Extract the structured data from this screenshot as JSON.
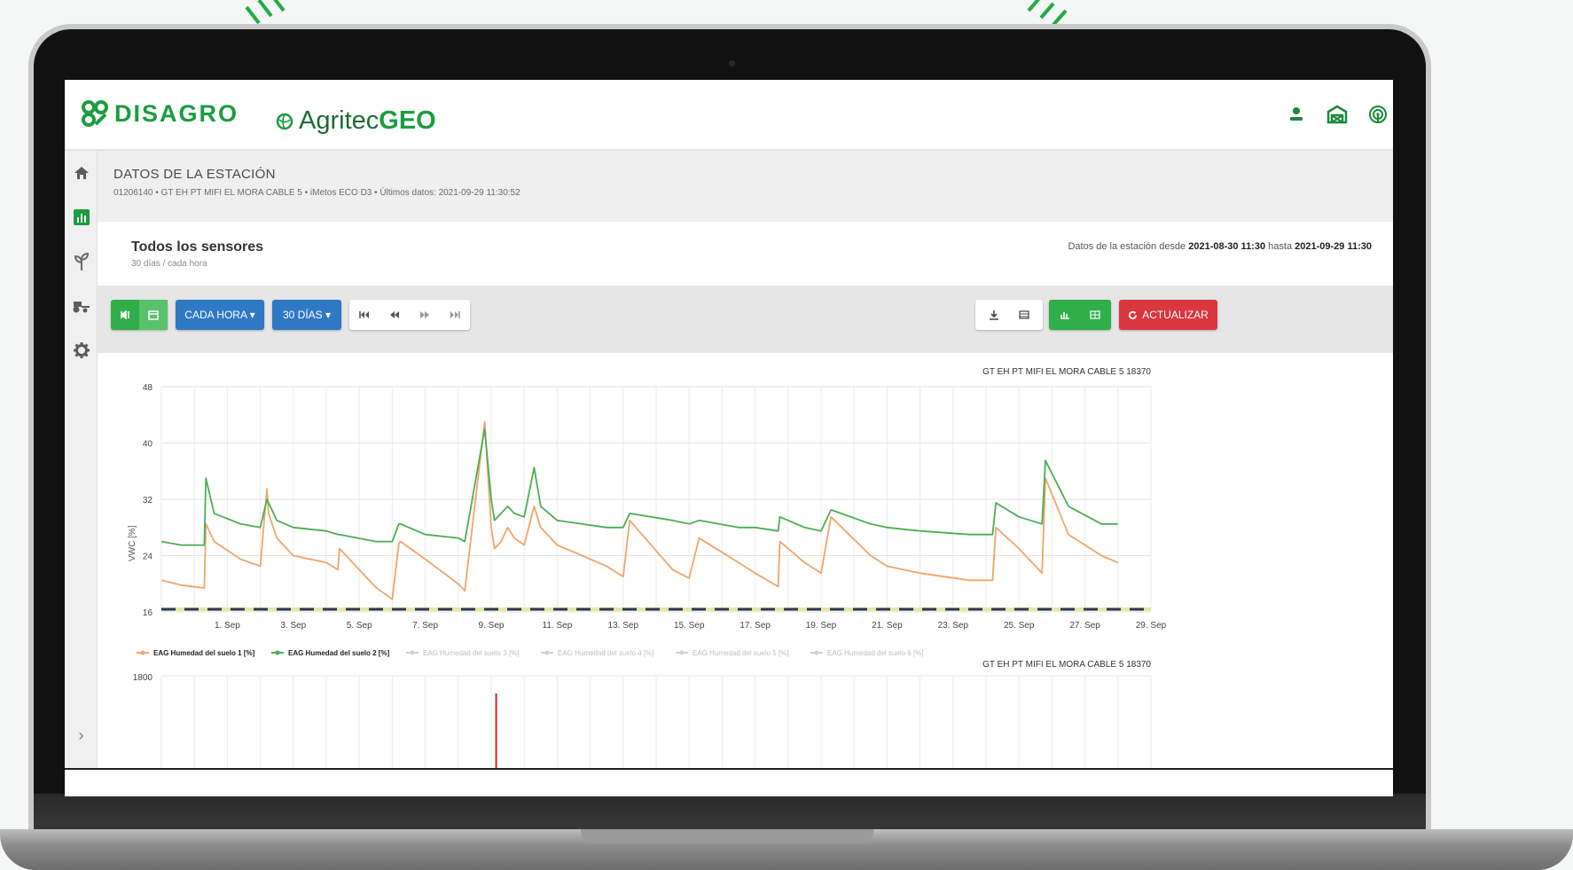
{
  "app": {
    "brand_disagro": "DISAGRO",
    "brand_agritec_prefix": "Agritec",
    "brand_agritec_suffix": "GEO"
  },
  "header_icons": [
    "user-icon",
    "farm-icon",
    "station-signal-icon"
  ],
  "sidebar": {
    "items": [
      "home-icon",
      "chart-icon",
      "plant-icon",
      "tractor-icon",
      "gear-icon"
    ],
    "expand": "›"
  },
  "station": {
    "title": "DATOS DE LA ESTACIÓN",
    "subtitle": "01206140 • GT EH PT MIFI EL MORA CABLE 5 • iMetos ECO D3 • Últimos datos: 2021-09-29 11:30:52"
  },
  "sensors": {
    "title": "Todos los sensores",
    "subtitle": "30 días / cada hora",
    "range_prefix": "Datos de la estación desde",
    "range_from": "2021-08-30 11:30",
    "range_mid": "hasta",
    "range_to": "2021-09-29 11:30"
  },
  "toolbar": {
    "interval_label": "CADA HORA ▾",
    "period_label": "30 DÍAS ▾",
    "refresh_label": "ACTUALIZAR",
    "colors": {
      "green": "#2fae4a",
      "blue": "#2f78c4",
      "red": "#d9363e"
    }
  },
  "chart_data": {
    "type": "line",
    "title": "GT EH PT MIFI EL MORA CABLE 5 18370",
    "ylabel": "VWC [%]",
    "ylim": [
      16,
      48
    ],
    "yticks": [
      16,
      24,
      32,
      40,
      48
    ],
    "xticks": [
      "1. Sep",
      "3. Sep",
      "5. Sep",
      "7. Sep",
      "9. Sep",
      "11. Sep",
      "13. Sep",
      "15. Sep",
      "17. Sep",
      "19. Sep",
      "21. Sep",
      "23. Sep",
      "25. Sep",
      "27. Sep",
      "29. Sep"
    ],
    "x_days": [
      0,
      0.6,
      1.3,
      1.35,
      1.6,
      2.4,
      3,
      3.2,
      3.25,
      3.5,
      4,
      5,
      5.35,
      5.4,
      6.5,
      7,
      7.2,
      7.25,
      8,
      9.0,
      9.2,
      9.8,
      10.0,
      10.1,
      10.3,
      10.5,
      10.7,
      11.0,
      11.3,
      11.5,
      12.0,
      13.5,
      14.0,
      14.2,
      15.5,
      16.0,
      16.3,
      17.5,
      18.0,
      18.7,
      18.75,
      19.5,
      20.0,
      20.3,
      21.5,
      22.0,
      23.0,
      24.5,
      25.2,
      25.3,
      26.0,
      26.7,
      26.8,
      27.5,
      28.5,
      29.0
    ],
    "series": [
      {
        "name": "EAG Humedad del suelo 1 [%]",
        "color": "#f0a56a",
        "values": [
          20.5,
          19.8,
          19.4,
          28.5,
          26,
          23.5,
          22.5,
          33.5,
          30,
          26.5,
          24,
          23,
          22,
          25,
          19.5,
          17.8,
          25.7,
          26,
          23.5,
          20,
          19,
          43,
          28,
          25,
          26,
          28,
          26.5,
          25.5,
          31,
          28,
          25.5,
          22.5,
          21,
          29,
          22,
          20.8,
          26.5,
          23,
          21.5,
          19.6,
          26,
          23,
          21.5,
          29.5,
          24,
          22.5,
          21.5,
          20.5,
          20.5,
          28,
          25,
          21.5,
          35,
          27,
          24,
          23
        ]
      },
      {
        "name": "EAG Humedad del suelo 2 [%]",
        "color": "#4cae55",
        "values": [
          26,
          25.5,
          25.5,
          35,
          30,
          28.5,
          28,
          32,
          31.5,
          29,
          28,
          27.5,
          27,
          27,
          26,
          26,
          28.5,
          28.5,
          27,
          26.5,
          26,
          42,
          32,
          29,
          30,
          31,
          30,
          29.5,
          36.5,
          31,
          29,
          28,
          28,
          30,
          29,
          28.5,
          29,
          28,
          28,
          27.5,
          29.5,
          28,
          27.5,
          30.5,
          28.5,
          28,
          27.5,
          27,
          27,
          31.5,
          29.5,
          28.5,
          37.5,
          31,
          28.5,
          28.5
        ]
      },
      {
        "name": "EAG Humedad del suelo 3 [%]",
        "color": "#d0d0d0",
        "values": []
      },
      {
        "name": "EAG Humedad del suelo 4 [%]",
        "color": "#d0d0d0",
        "values": []
      },
      {
        "name": "EAG Humedad del suelo 5 [%]",
        "color": "#d0d0d0",
        "values": []
      },
      {
        "name": "EAG Humedad del suelo 6 [%]",
        "color": "#d0d0d0",
        "values": []
      }
    ],
    "second_chart": {
      "title": "GT EH PT MIFI EL MORA CABLE 5 18370",
      "ytick_top": 1800
    },
    "grid": true,
    "legend": "bottom-left"
  }
}
